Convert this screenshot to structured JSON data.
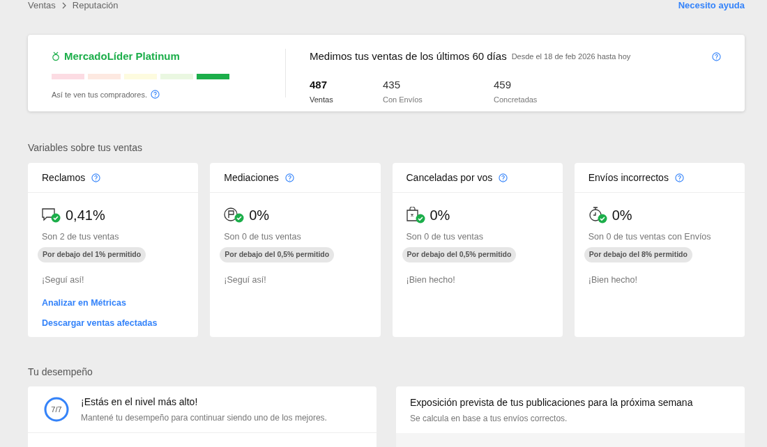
{
  "breadcrumb": [
    "Ventas",
    "Reputación"
  ],
  "help_link": "Necesito ayuda",
  "summary": {
    "level_title": "MercadoLíder Platinum",
    "thermometer": [
      {
        "color": "#fcdce3"
      },
      {
        "color": "#fde9e1"
      },
      {
        "color": "#fdfbdf"
      },
      {
        "color": "#eaf7e1"
      },
      {
        "color": "#1cae4a"
      }
    ],
    "caption": "Así te ven tus compradores.",
    "period_title": "Medimos tus ventas de los últimos 60 días",
    "period_range": "Desde el 18 de feb 2026 hasta hoy",
    "stats": [
      {
        "value": "487",
        "label": "Ventas",
        "emphasis": true
      },
      {
        "value": "435",
        "label": "Con Envíos",
        "emphasis": false
      },
      {
        "value": "459",
        "label": "Concretadas",
        "emphasis": false
      }
    ]
  },
  "variables_title": "Variables sobre tus ventas",
  "metrics": [
    {
      "title": "Reclamos",
      "kind": "chat",
      "value": "0,41%",
      "detail": "Son 2 de tus ventas",
      "badge": "Por debajo del 1% permitido",
      "message": "¡Seguí así!",
      "links": [
        "Analizar en Métricas",
        "Descargar ventas afectadas"
      ]
    },
    {
      "title": "Mediaciones",
      "kind": "flag",
      "value": "0%",
      "detail": "Son 0 de tus ventas",
      "badge": "Por debajo del 0,5% permitido",
      "message": "¡Seguí así!"
    },
    {
      "title": "Canceladas por vos",
      "kind": "bag",
      "value": "0%",
      "detail": "Son 0 de tus ventas",
      "badge": "Por debajo del 0,5% permitido",
      "message": "¡Bien hecho!"
    },
    {
      "title": "Envíos incorrectos",
      "kind": "timer",
      "value": "0%",
      "detail": "Son 0 de tus ventas con Envíos",
      "badge": "Por debajo del 8% permitido",
      "message": "¡Bien hecho!"
    }
  ],
  "performance_title": "Tu desempeño",
  "performance": {
    "level": 1,
    "score": "7/7",
    "title": "¡Estás en el nivel más alto!",
    "subtitle": "Mantené tu desempeño para continuar siendo uno de los mejores."
  },
  "exposure": {
    "title": "Exposición prevista de tus publicaciones para la próxima semana",
    "subtitle": "Se calcula en base a tus envíos correctos."
  }
}
